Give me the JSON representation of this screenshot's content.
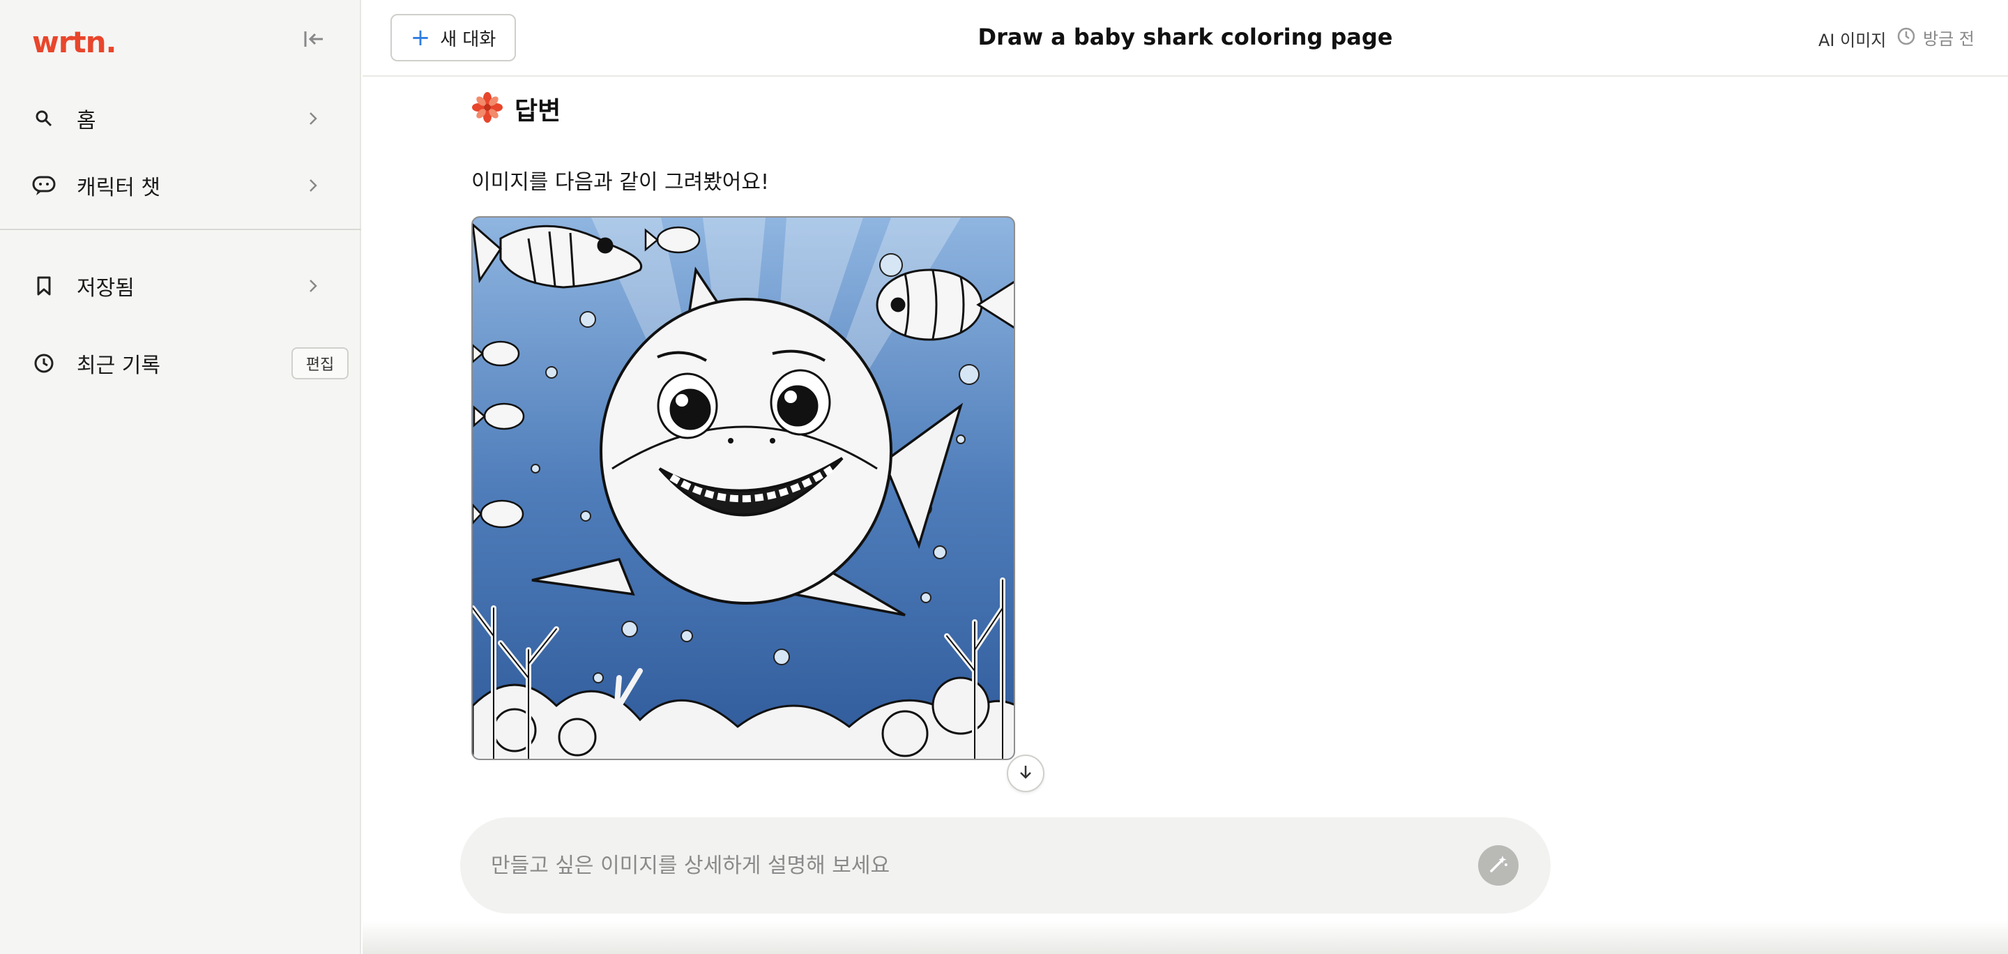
{
  "sidebar": {
    "logo": "wrtn.",
    "items": [
      {
        "label": "홈",
        "icon": "search-icon"
      },
      {
        "label": "캐릭터 챗",
        "icon": "chat-bubble-icon"
      },
      {
        "label": "저장됨",
        "icon": "bookmark-icon"
      },
      {
        "label": "최근 기록",
        "icon": "clock-icon"
      }
    ],
    "edit_label": "편집"
  },
  "header": {
    "new_chat_label": "새 대화",
    "title": "Draw a baby shark coloring page",
    "ai_image_label": "AI 이미지",
    "time_label": "방금 전"
  },
  "answer": {
    "heading": "답변",
    "message": "이미지를 다음과 같이 그려봤어요!",
    "image_alt": "baby shark coloring page"
  },
  "composer": {
    "placeholder": "만들고 싶은 이미지를 상세하게 설명해 보세요"
  },
  "colors": {
    "brand": "#e8462c",
    "accent_plus": "#2f7de1"
  }
}
